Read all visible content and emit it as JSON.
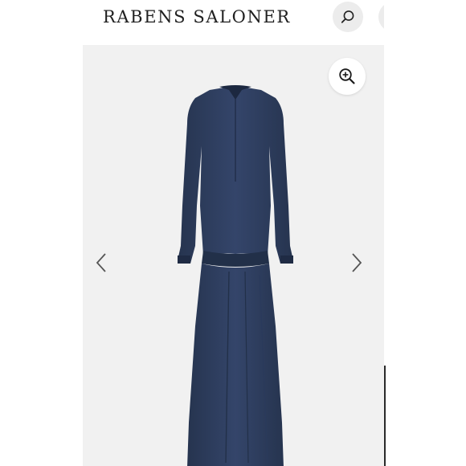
{
  "brand": {
    "name": "RABENS SALONER"
  },
  "icons": {
    "search": "search-icon",
    "zoom": "zoom-in-icon",
    "prev": "chevron-left-icon",
    "next": "chevron-right-icon"
  },
  "colors": {
    "dress": "#2b3a5a",
    "gallery_background": "#f1f1f1",
    "button_background": "#ececec"
  }
}
